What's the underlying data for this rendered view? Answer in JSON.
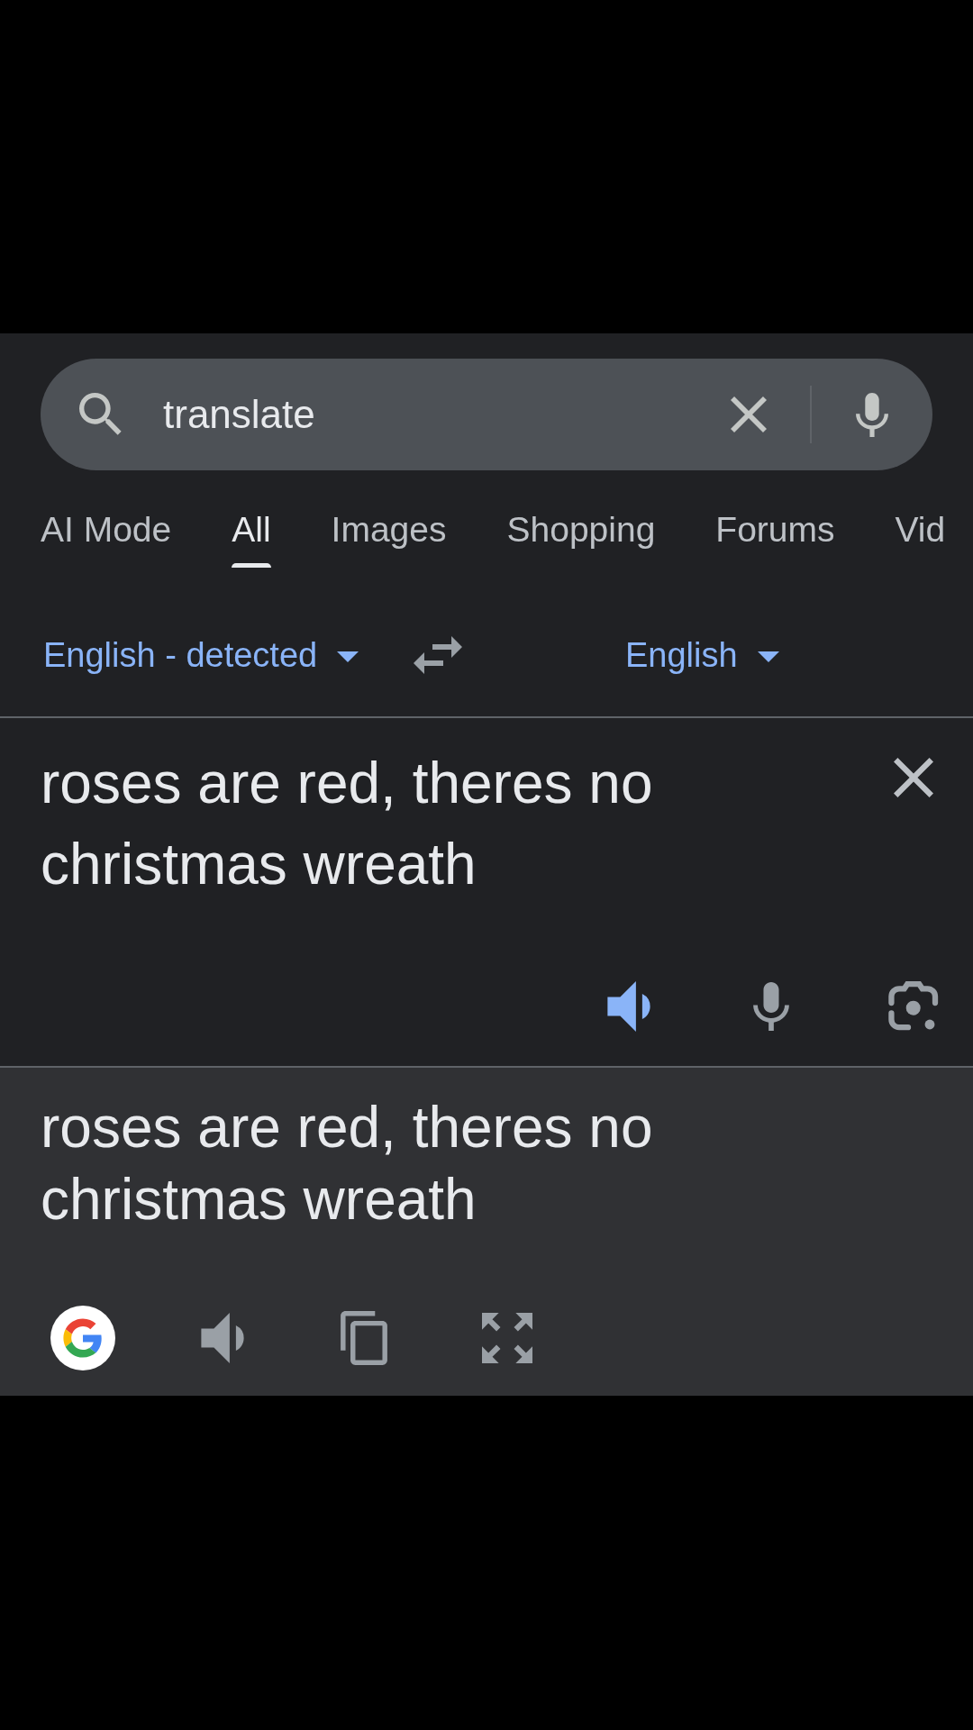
{
  "search": {
    "value": "translate"
  },
  "tabs": [
    {
      "label": "AI Mode",
      "selected": false
    },
    {
      "label": "All",
      "selected": true
    },
    {
      "label": "Images",
      "selected": false
    },
    {
      "label": "Shopping",
      "selected": false
    },
    {
      "label": "Forums",
      "selected": false
    },
    {
      "label": "Vid",
      "selected": false
    }
  ],
  "translator": {
    "source_language": "English - detected",
    "target_language": "English",
    "input": {
      "text": "roses are red, theres no christmas wreath",
      "speaker": {
        "active": true
      }
    },
    "output": {
      "text": "roses are red, theres no christmas wreath",
      "speaker": {
        "active": false
      }
    }
  }
}
